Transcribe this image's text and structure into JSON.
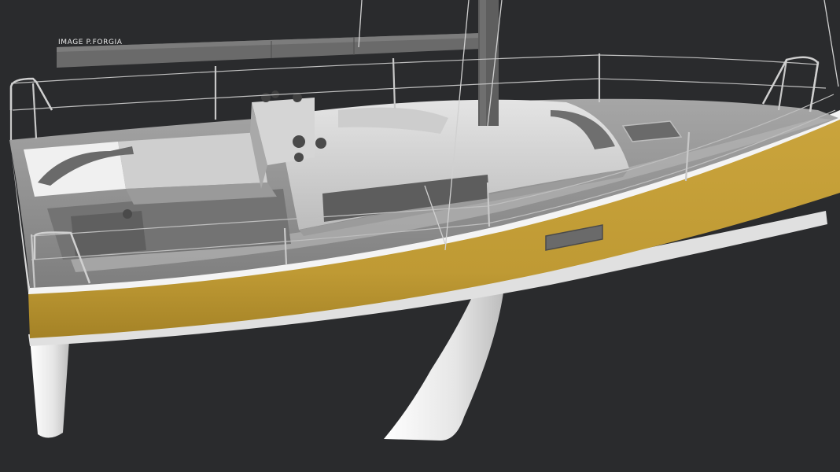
{
  "image": {
    "credit": "IMAGE P.FORGIA"
  },
  "palette": {
    "background": "#2a2b2d",
    "hull_gold": "#c9a23a",
    "hull_gold_dark": "#a9852a",
    "deck_grey": "#8e8e8e",
    "deck_light": "#d8d8d8",
    "white_parts": "#f2f2f2",
    "mast_grey": "#5e5e5e"
  }
}
